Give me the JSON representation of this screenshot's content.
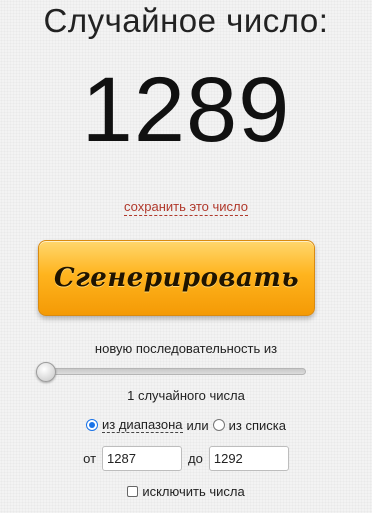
{
  "title": "Случайное число:",
  "result": "1289",
  "save_link": "сохранить это число",
  "generate_button": "Сгенерировать",
  "sequence_label": "новую последовательность из",
  "count_label": "1 случайного числа",
  "source": {
    "range_label": "из диапазона",
    "or_label": "или",
    "list_label": "из списка",
    "selected": "range"
  },
  "range": {
    "from_label": "от",
    "from_value": "1287",
    "to_label": "до",
    "to_value": "1292"
  },
  "exclude_label": "исключить числа",
  "colors": {
    "button_orange": "#ffb41e",
    "link_red": "#b0382b",
    "radio_blue": "#1a73e8"
  }
}
